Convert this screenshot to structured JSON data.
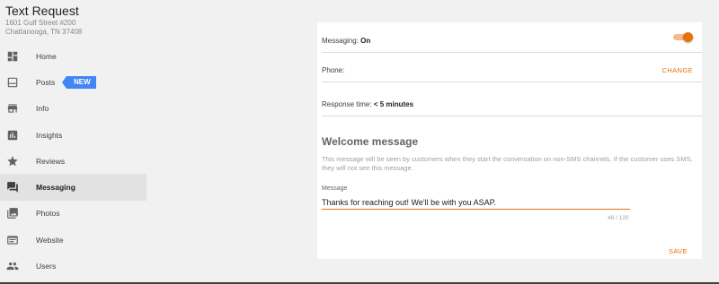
{
  "business": {
    "name": "Text Request",
    "address_line1": "1601 Gulf Street #200",
    "address_line2": "Chattanooga, TN 37408"
  },
  "sidebar": {
    "items": [
      {
        "label": "Home",
        "icon": "dashboard-icon"
      },
      {
        "label": "Posts",
        "icon": "posts-icon",
        "badge": "NEW"
      },
      {
        "label": "Info",
        "icon": "storefront-icon"
      },
      {
        "label": "Insights",
        "icon": "insights-icon"
      },
      {
        "label": "Reviews",
        "icon": "star-icon"
      },
      {
        "label": "Messaging",
        "icon": "chat-icon",
        "active": true
      },
      {
        "label": "Photos",
        "icon": "photos-icon"
      },
      {
        "label": "Website",
        "icon": "website-icon"
      },
      {
        "label": "Users",
        "icon": "users-icon"
      }
    ]
  },
  "messaging": {
    "status_label": "Messaging: ",
    "status_value": "On",
    "toggle_on": true,
    "phone_label": "Phone:",
    "change_label": "CHANGE",
    "response_label": "Response time: ",
    "response_value": "< 5 minutes"
  },
  "welcome": {
    "title": "Welcome message",
    "description": "This message will be seen by customers when they start the conversation on non-SMS channels. If the customer uses SMS, they will not see this message.",
    "message_label": "Message",
    "message_value": "Thanks for reaching out! We'll be with you ASAP.",
    "counter": "48 / 120",
    "save_label": "SAVE"
  },
  "colors": {
    "accent": "#e8710a",
    "badge": "#4285f4"
  }
}
